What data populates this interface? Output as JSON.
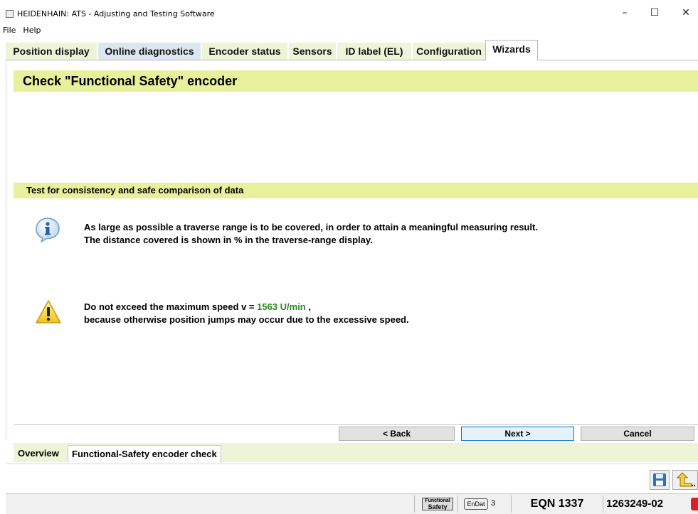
{
  "window": {
    "title": "HEIDENHAIN: ATS - Adjusting and Testing Software",
    "controls": {
      "minimize": "–",
      "maximize": "☐",
      "close": "✕"
    }
  },
  "menu": {
    "items": [
      "File",
      "Help"
    ]
  },
  "tabs": [
    {
      "label": "Position display"
    },
    {
      "label": "Online diagnostics"
    },
    {
      "label": "Encoder status"
    },
    {
      "label": "Sensors"
    },
    {
      "label": "ID label (EL)"
    },
    {
      "label": "Configuration"
    },
    {
      "label": "Wizards",
      "active": true
    }
  ],
  "wizard": {
    "title": "Check \"Functional Safety\" encoder",
    "section_title": "Test for consistency and safe comparison of data",
    "info": {
      "icon": "info-icon",
      "line1": "As large as possible a traverse range is to be covered, in order to attain a meaningful measuring result.",
      "line2": "The distance covered is shown in % in the traverse-range display."
    },
    "warning": {
      "icon": "warning-icon",
      "prefix": "Do not exceed the maximum speed v = ",
      "speed": "1563 U/min",
      "suffix": " ,",
      "line2": "because otherwise position jumps may occur due to the excessive speed."
    },
    "buttons": {
      "back": "< Back",
      "next": "Next >",
      "cancel": "Cancel"
    }
  },
  "bottom_tabs": [
    {
      "label": "Overview"
    },
    {
      "label": "Functional-Safety encoder check",
      "active": true
    }
  ],
  "toolbar": {
    "icons": [
      "save-icon",
      "exit-icon"
    ]
  },
  "status": {
    "fs_badge_top": "Functional",
    "fs_badge_bottom": "Safety",
    "interface_badge": "EnDat",
    "interface_version": "3",
    "encoder": "EQN 1337",
    "id_number": "1263249-02"
  },
  "colors": {
    "banner": "#e7f09a",
    "tab_bg": "#eef4d8",
    "speed_value": "#2a8a1e",
    "focus_border": "#0078d7"
  }
}
